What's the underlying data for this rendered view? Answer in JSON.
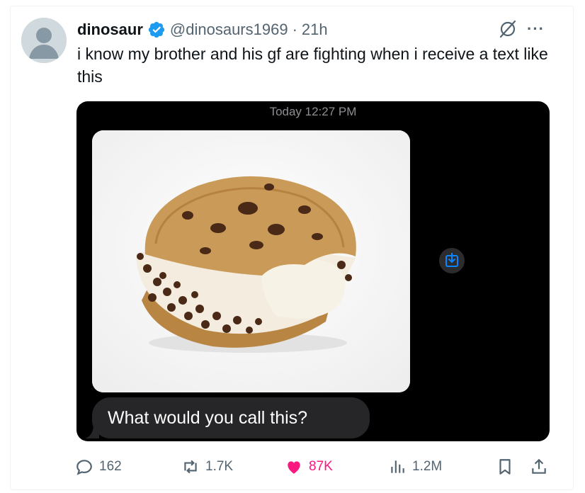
{
  "tweet": {
    "display_name": "dinosaur",
    "handle": "@dinosaurs1969",
    "separator": "·",
    "time": "21h",
    "text": "i know my brother and his gf are fighting when i receive a text like this",
    "more_label": "···"
  },
  "media": {
    "timestamp": "Today 12:27 PM",
    "message": "What would you call this?",
    "photo_alt": "ice cream cookie sandwich with a bite taken out"
  },
  "actions": {
    "replies": "162",
    "reposts": "1.7K",
    "likes": "87K",
    "views": "1.2M"
  },
  "colors": {
    "verified": "#1d9bf0",
    "like": "#f91880",
    "muted": "#536471",
    "save_icon": "#0a84ff"
  },
  "icons": [
    "verified-badge-icon",
    "grok-icon",
    "more-icon",
    "save-to-photos-icon",
    "reply-icon",
    "repost-icon",
    "like-icon",
    "views-icon",
    "bookmark-icon",
    "share-icon"
  ]
}
